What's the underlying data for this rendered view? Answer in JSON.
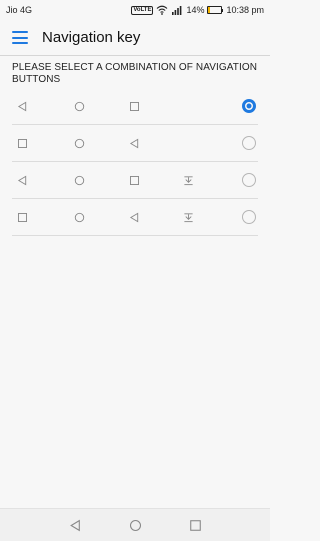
{
  "status_bar": {
    "carrier": "Jio 4G",
    "volte_label": "VoLTE",
    "battery_percent": "14%",
    "battery_level": 0.14,
    "time": "10:38 pm"
  },
  "header": {
    "title": "Navigation key"
  },
  "section": {
    "title": "PLEASE SELECT A COMBINATION OF NAVIGATION BUTTONS"
  },
  "options": [
    {
      "buttons": [
        "back-icon",
        "home-icon",
        "recents-icon"
      ],
      "selected": true
    },
    {
      "buttons": [
        "recents-icon",
        "home-icon",
        "back-icon"
      ],
      "selected": false
    },
    {
      "buttons": [
        "back-icon",
        "home-icon",
        "recents-icon",
        "notification-pull-down-icon"
      ],
      "selected": false
    },
    {
      "buttons": [
        "recents-icon",
        "home-icon",
        "back-icon",
        "notification-pull-down-icon"
      ],
      "selected": false
    }
  ],
  "colors": {
    "accent": "#1f7ae0",
    "icon_gray": "#888888",
    "battery_low": "#f3b400"
  },
  "system_nav": [
    "back-icon",
    "home-icon",
    "recents-icon"
  ]
}
